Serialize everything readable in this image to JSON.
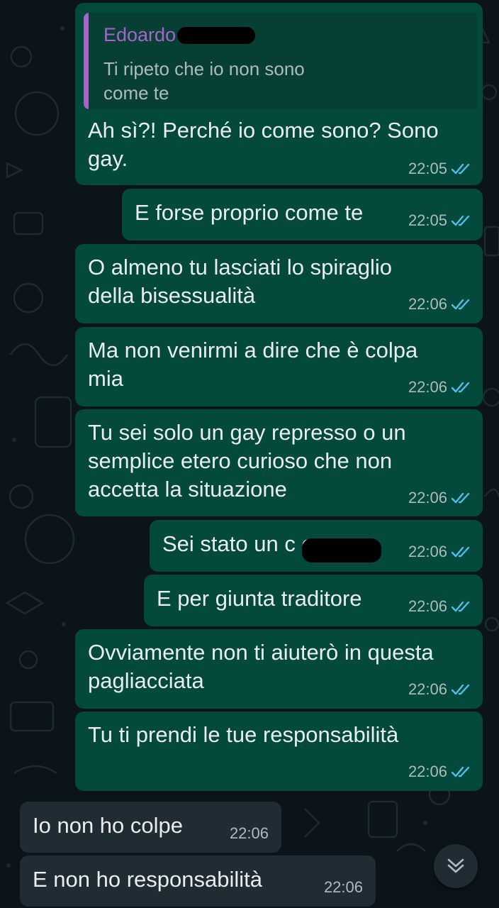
{
  "colors": {
    "background": "#0b141a",
    "outgoing_bubble": "#034a3c",
    "incoming_bubble": "#1f2c34",
    "quote_bar": "#a865c9",
    "read_ticks": "#53bdeb",
    "meta_text": "#aebac1"
  },
  "chat": {
    "reply_quote": {
      "author": "Edoardo",
      "text": "Ti ripeto che io non sono\ncome te"
    },
    "messages": [
      {
        "direction": "outgoing",
        "text": "Ah sì?! Perché io come sono? Sono\ngay.",
        "time": "22:05",
        "status": "read"
      },
      {
        "direction": "outgoing",
        "text": "E forse proprio come te",
        "time": "22:05",
        "status": "read"
      },
      {
        "direction": "outgoing",
        "text": "O almeno tu lasciati lo spiraglio\ndella bisessualità",
        "time": "22:06",
        "status": "read"
      },
      {
        "direction": "outgoing",
        "text": "Ma non venirmi a dire che è colpa\nmia",
        "time": "22:06",
        "status": "read"
      },
      {
        "direction": "outgoing",
        "text": "Tu sei solo un gay represso o un\nsemplice etero curioso che non\naccetta la situazione",
        "time": "22:06",
        "status": "read"
      },
      {
        "direction": "outgoing",
        "text": "Sei stato un c          e",
        "time": "22:06",
        "status": "read"
      },
      {
        "direction": "outgoing",
        "text": "E per giunta traditore",
        "time": "22:06",
        "status": "read"
      },
      {
        "direction": "outgoing",
        "text": "Ovviamente non ti aiuterò in questa\npagliacciata",
        "time": "22:06",
        "status": "read"
      },
      {
        "direction": "outgoing",
        "text": "Tu ti prendi le tue responsabilità",
        "time": "22:06",
        "status": "read"
      },
      {
        "direction": "incoming",
        "text": "Io non ho colpe",
        "time": "22:06"
      },
      {
        "direction": "incoming",
        "text": "E non ho responsabilità",
        "time": "22:06"
      }
    ]
  },
  "icons": {
    "read_status": "double-check-icon",
    "scroll_down": "chevron-double-down-icon"
  }
}
